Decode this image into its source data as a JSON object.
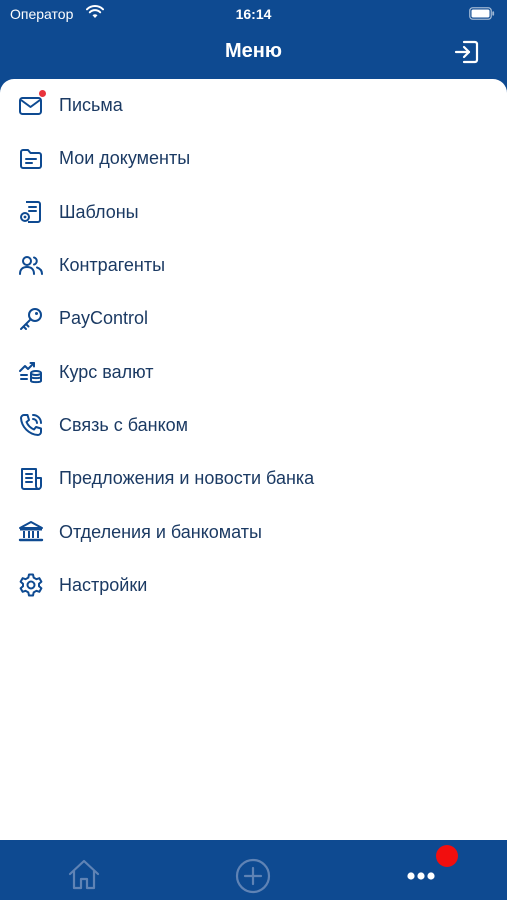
{
  "status_bar": {
    "carrier": "Оператор",
    "time": "16:14"
  },
  "header": {
    "title": "Меню",
    "logout_icon": "logout-icon"
  },
  "menu": {
    "items": [
      {
        "label": "Письма",
        "icon": "mail-icon",
        "badge": true
      },
      {
        "label": "Мои документы",
        "icon": "folder-icon"
      },
      {
        "label": "Шаблоны",
        "icon": "template-icon"
      },
      {
        "label": "Контрагенты",
        "icon": "contacts-icon"
      },
      {
        "label": "PayControl",
        "icon": "key-icon"
      },
      {
        "label": "Курс валют",
        "icon": "exchange-rate-icon"
      },
      {
        "label": "Связь с банком",
        "icon": "phone-icon"
      },
      {
        "label": "Предложения и новости банка",
        "icon": "news-icon"
      },
      {
        "label": "Отделения и банкоматы",
        "icon": "bank-icon"
      },
      {
        "label": "Настройки",
        "icon": "settings-icon"
      }
    ]
  },
  "tab_bar": {
    "tabs": [
      {
        "icon": "home-icon",
        "active": false
      },
      {
        "icon": "add-icon",
        "active": false
      },
      {
        "icon": "more-icon",
        "active": true,
        "has_notification": true
      }
    ]
  },
  "colors": {
    "primary": "#0e4a91",
    "text": "#1b3a63",
    "badge": "#e8333c",
    "notification": "#f20e0e"
  }
}
